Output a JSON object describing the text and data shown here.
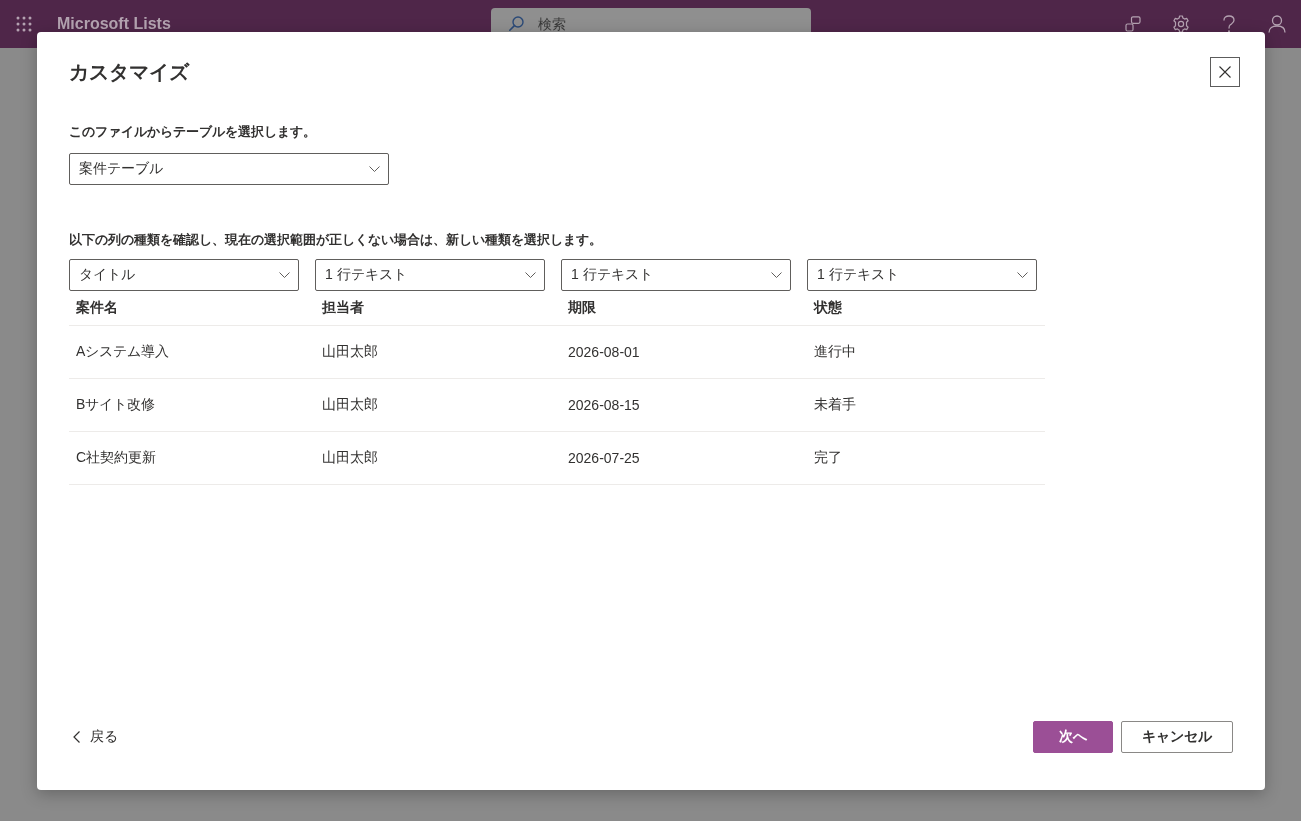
{
  "app_bar": {
    "app_name": "Microsoft Lists",
    "search": {
      "placeholder": "検索"
    }
  },
  "dialog": {
    "title": "カスタマイズ",
    "table_select": {
      "label": "このファイルからテーブルを選択します。",
      "value": "案件テーブル"
    },
    "column_types": {
      "instruction": "以下の列の種類を確認し、現在の選択範囲が正しくない場合は、新しい種類を選択します。",
      "values": [
        "タイトル",
        "1 行テキスト",
        "1 行テキスト",
        "1 行テキスト"
      ]
    },
    "table": {
      "columns": [
        "案件名",
        "担当者",
        "期限",
        "状態"
      ],
      "rows": [
        [
          "Aシステム導入",
          "山田太郎",
          "2026-08-01",
          "進行中"
        ],
        [
          "Bサイト改修",
          "山田太郎",
          "2026-08-15",
          "未着手"
        ],
        [
          "C社契約更新",
          "山田太郎",
          "2026-07-25",
          "完了"
        ]
      ]
    },
    "back_link": {
      "label": "戻る"
    },
    "buttons": [
      {
        "label": "次へ",
        "kind": "primary"
      },
      {
        "label": "キャンセル",
        "kind": "secondary"
      }
    ]
  }
}
